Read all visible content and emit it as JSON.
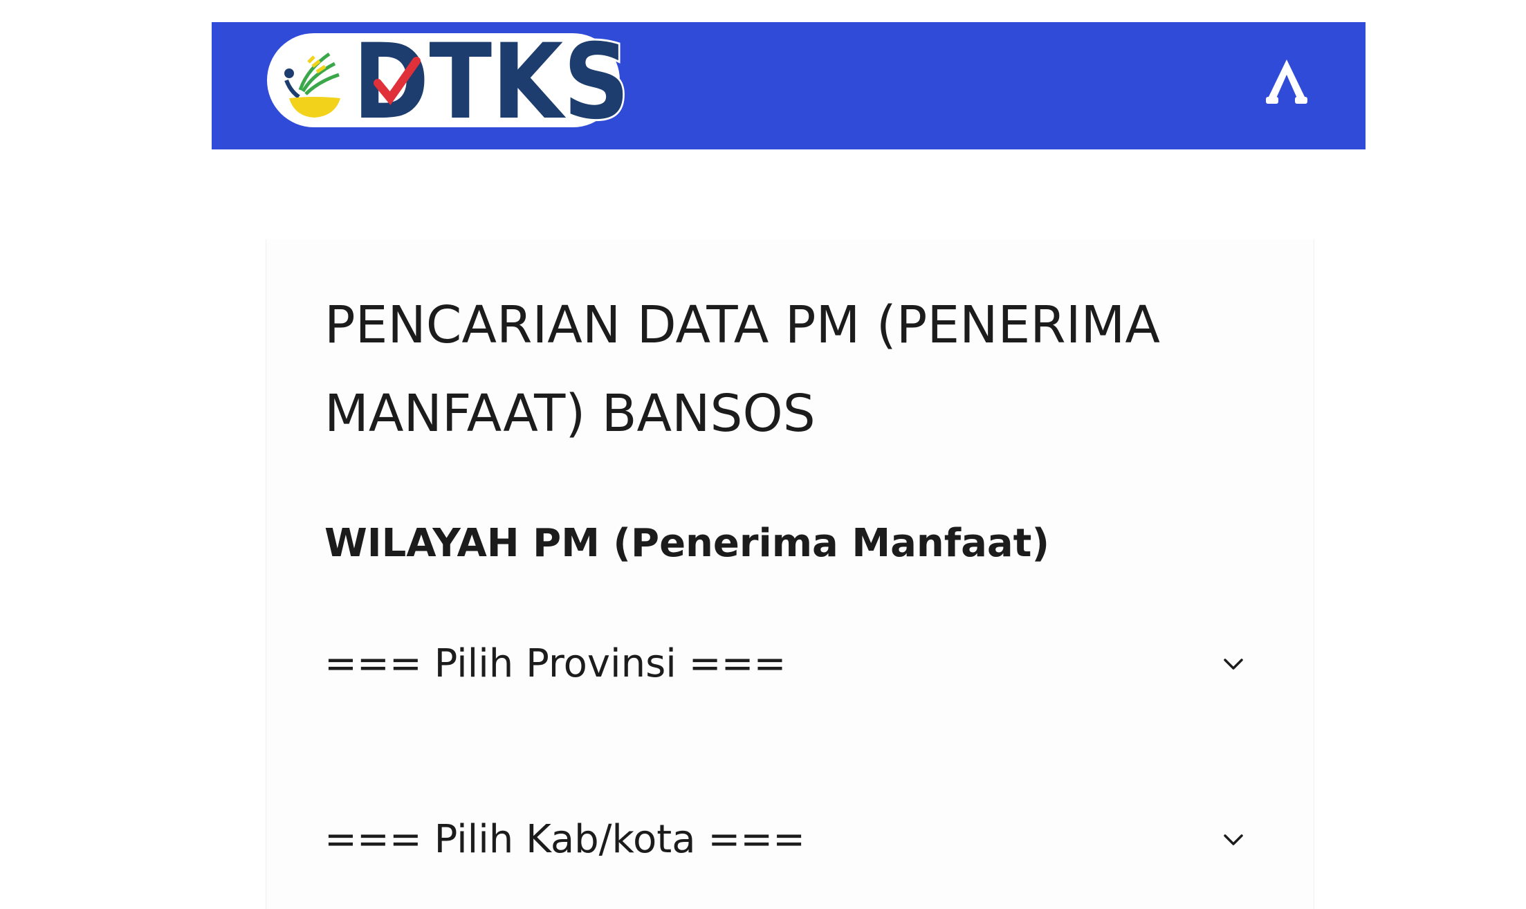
{
  "header": {
    "logo_text": "DTKS",
    "background_color": "#2f4bd8",
    "menu_icon": "caret-up-icon"
  },
  "form": {
    "title": "PENCARIAN DATA PM (PENERIMA MANFAAT) BANSOS",
    "section_label": "WILAYAH PM (Penerima Manfaat)",
    "provinsi_select": {
      "value": "=== Pilih Provinsi ===",
      "icon": "chevron-down-icon"
    },
    "kabkota_select": {
      "value": "=== Pilih Kab/kota ===",
      "icon": "chevron-down-icon"
    }
  },
  "colors": {
    "logo_navy": "#1d3d6e",
    "logo_check": "#e0303a",
    "text": "#1c1c1c"
  }
}
